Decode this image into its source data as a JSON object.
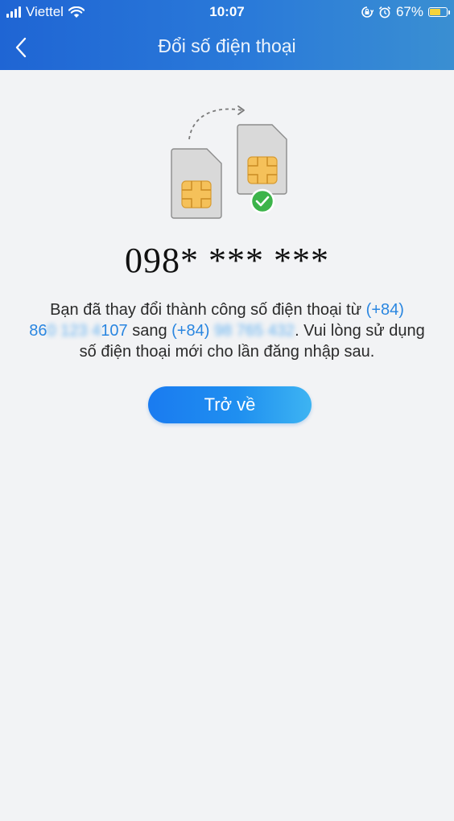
{
  "status_bar": {
    "carrier": "Viettel",
    "time": "10:07",
    "battery_percent": "67%",
    "battery_level": 0.67,
    "icons": [
      "signal-icon",
      "wifi-icon",
      "orientation-lock-icon",
      "alarm-icon",
      "battery-icon"
    ]
  },
  "header": {
    "title": "Đổi số điện thoại",
    "back_icon": "chevron-left-icon"
  },
  "illustration": {
    "icons": [
      "old-sim-icon",
      "new-sim-icon",
      "dashed-arrow-icon",
      "check-circle-icon"
    ],
    "colors": {
      "sim": "#d9d9d9",
      "chip": "#f5c15a",
      "check": "#3cb44a"
    }
  },
  "main": {
    "phone_number": "098* *** ***",
    "message": {
      "part1": "Bạn đã thay đổi thành công số điện thoại từ ",
      "old_prefix": "(+84)",
      "old_number_start": "86",
      "old_number_hidden": "0 123 4",
      "old_number_end": "107",
      "part2": " sang ",
      "new_prefix": "(+84)",
      "new_number_hidden": "98 765 432",
      "part3": ". Vui lòng sử dụng số điện thoại mới cho lần đăng nhập sau."
    },
    "back_button": "Trở về"
  },
  "colors": {
    "header_start": "#1f65d4",
    "header_end": "#3a8fd2",
    "link_blue": "#2a86e0",
    "button_start": "#1a7bf0",
    "button_end": "#3db4f2",
    "background": "#f2f3f5"
  }
}
